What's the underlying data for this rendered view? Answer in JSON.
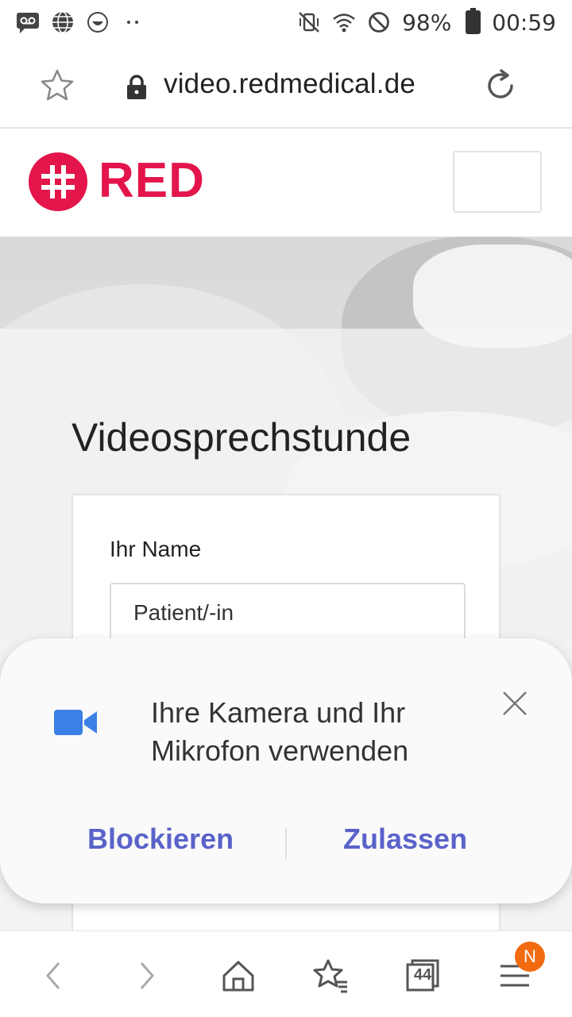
{
  "status_bar": {
    "battery": "98%",
    "time": "00:59"
  },
  "browser": {
    "url": "video.redmedical.de"
  },
  "site": {
    "logo_text": "RED",
    "brand_color": "#e3154b"
  },
  "page": {
    "title": "Videosprechstunde",
    "form": {
      "name_label": "Ihr Name",
      "name_value": "Patient/-in"
    }
  },
  "permission_dialog": {
    "message": "Ihre Kamera und Ihr Mikrofon verwenden",
    "block_label": "Blockieren",
    "allow_label": "Zulassen",
    "accent_color": "#5a63c9"
  },
  "bottom_nav": {
    "tab_count": "44",
    "badge": "N"
  }
}
